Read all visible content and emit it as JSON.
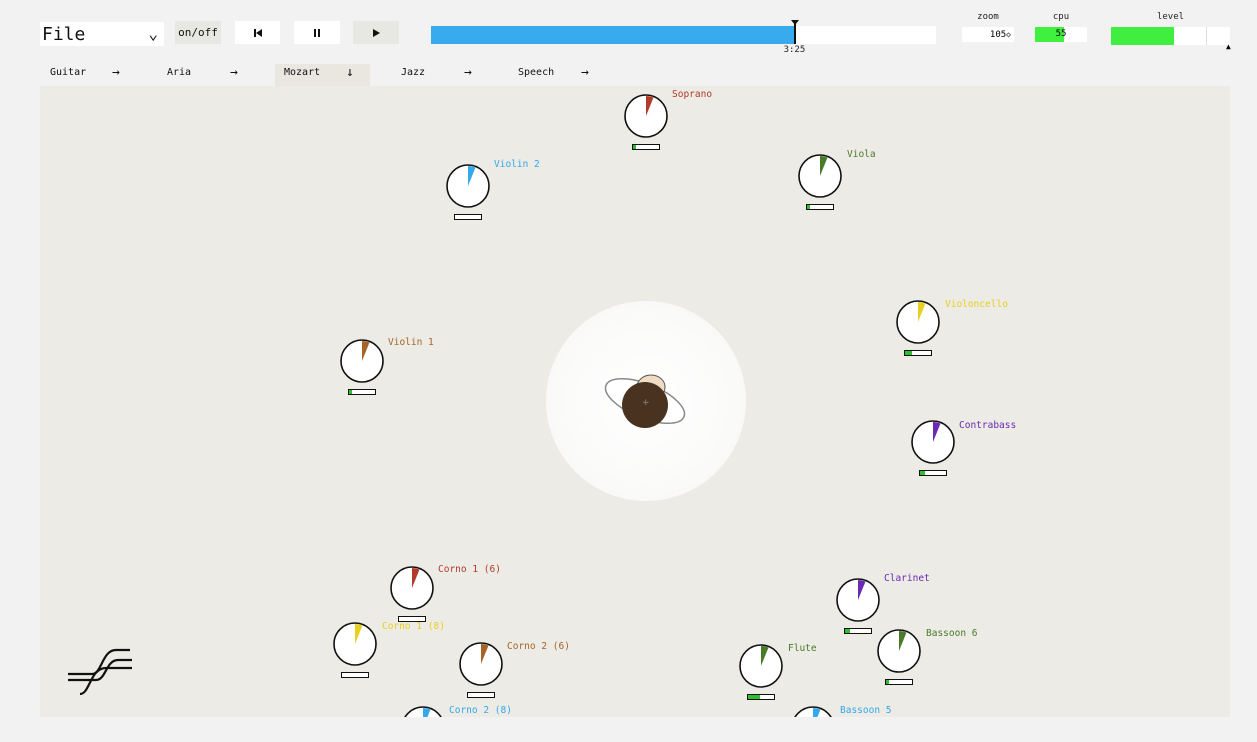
{
  "toolbar": {
    "file_label": "File",
    "onoff_label": "on/off",
    "skip_back_icon": "skip-back-icon",
    "pause_icon": "pause-icon",
    "play_icon": "play-icon",
    "time_label": "3:25",
    "progress_fraction": 0.72,
    "zoom_caption": "zoom",
    "zoom_value": "105",
    "cpu_caption": "cpu",
    "cpu_value": "55",
    "cpu_fraction": 0.55,
    "level_caption": "level",
    "level_fraction": 0.53
  },
  "tabs": [
    {
      "label": "Guitar",
      "arrow": "→",
      "active": false
    },
    {
      "label": "Aria",
      "arrow": "→",
      "active": false
    },
    {
      "label": "Mozart",
      "arrow": "↓",
      "active": true
    },
    {
      "label": "Jazz",
      "arrow": "→",
      "active": false
    },
    {
      "label": "Speech",
      "arrow": "→",
      "active": false
    }
  ],
  "instruments": [
    {
      "name": "Soprano",
      "color": "#b23a2a",
      "level": 0.1
    },
    {
      "name": "Violin 2",
      "color": "#35a8ec",
      "level": 0.0
    },
    {
      "name": "Viola",
      "color": "#4a7a2a",
      "level": 0.12
    },
    {
      "name": "Violoncello",
      "color": "#e8d020",
      "level": 0.28
    },
    {
      "name": "Violin 1",
      "color": "#a56428",
      "level": 0.12
    },
    {
      "name": "Contrabass",
      "color": "#6a2ab2",
      "level": 0.2
    },
    {
      "name": "Corno 1 (6)",
      "color": "#b23a2a",
      "level": 0.0
    },
    {
      "name": "Corno 1 (8)",
      "color": "#e8d020",
      "level": 0.0
    },
    {
      "name": "Corno 2 (6)",
      "color": "#a56428",
      "level": 0.0
    },
    {
      "name": "Corno 2 (8)",
      "color": "#35a8ec",
      "level": 0.0
    },
    {
      "name": "Clarinet",
      "color": "#6a2ab2",
      "level": 0.2
    },
    {
      "name": "Bassoon 6",
      "color": "#4a7a2a",
      "level": 0.1
    },
    {
      "name": "Flute",
      "color": "#4a7a2a",
      "level": 0.45
    },
    {
      "name": "Bassoon 5",
      "color": "#35a8ec",
      "level": 0.0
    }
  ],
  "colors": {
    "accent_blue": "#38aaee",
    "meter_green": "#3ff03f",
    "stage_bg": "#ecebe5"
  },
  "logo_icon": "sound-wave-logo-icon",
  "listener_icon": "listener-head-icon"
}
